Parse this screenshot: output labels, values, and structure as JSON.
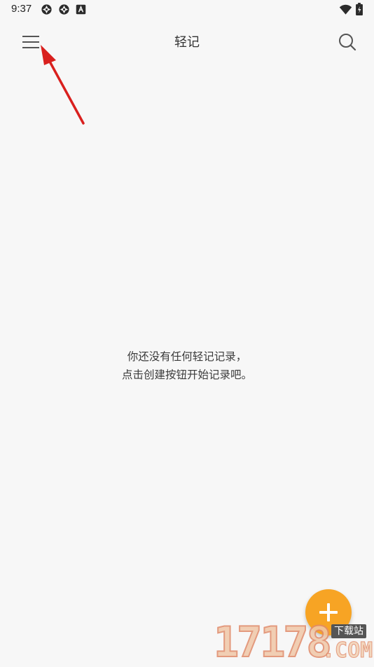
{
  "status_bar": {
    "time": "9:37",
    "left_icons": [
      "aperture-icon",
      "aperture-icon",
      "a-badge-icon"
    ],
    "right_icons": [
      "wifi-icon",
      "battery-icon"
    ]
  },
  "app_bar": {
    "title": "轻记",
    "menu_icon": "hamburger-menu-icon",
    "search_icon": "search-icon"
  },
  "empty_state": {
    "line1": "你还没有任何轻记记录，",
    "line2": "点击创建按钮开始记录吧。"
  },
  "fab": {
    "icon": "plus-icon",
    "color": "#f7a424"
  },
  "annotation": {
    "arrow_color": "#d9201e"
  },
  "watermark": {
    "digits": "17178",
    "domain": ".COM",
    "sublabel": "下载站"
  },
  "colors": {
    "background": "#f7f7f7",
    "text": "#333333",
    "icon": "#555555"
  }
}
